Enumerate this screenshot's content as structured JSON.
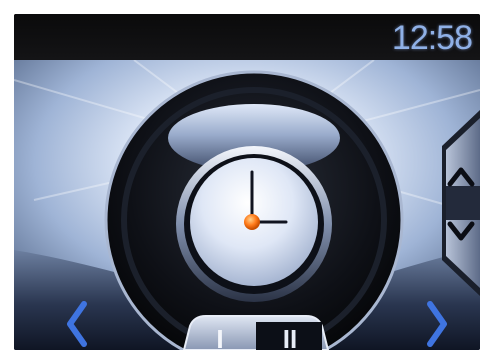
{
  "status_bar": {
    "time": "12:58"
  },
  "screen": {
    "center_icon": "analog-clock-icon",
    "colors": {
      "background": "#0b0b0d",
      "time_text": "#8fb0e6",
      "accent_blue": "#3f74e0",
      "clock_hand_tip": "#ff7a1a"
    }
  },
  "controls": {
    "prev_icon": "chevron-left-icon",
    "next_icon": "chevron-right-icon",
    "up_icon": "chevron-up-icon",
    "down_icon": "chevron-down-icon",
    "mode_one_label": "I",
    "mode_two_label": "II"
  }
}
